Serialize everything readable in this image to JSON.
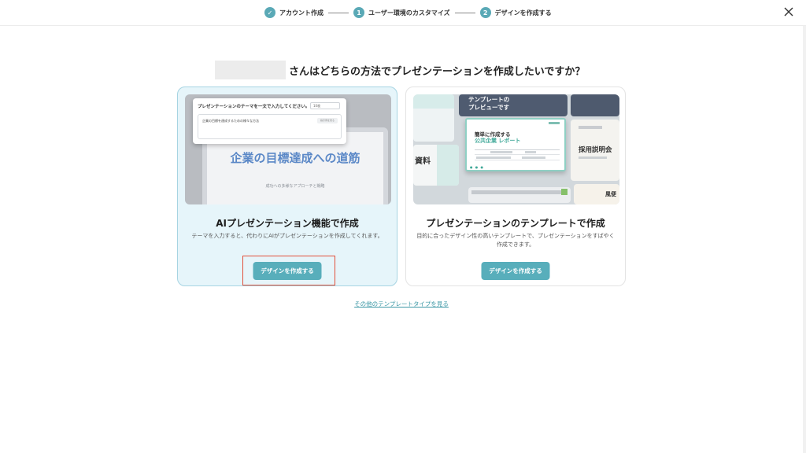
{
  "stepper": {
    "steps": [
      {
        "marker": "✓",
        "label": "アカウント作成"
      },
      {
        "marker": "1",
        "label": "ユーザー環境のカスタマイズ"
      },
      {
        "marker": "2",
        "label": "デザインを作成する"
      }
    ]
  },
  "heading": {
    "question": "さんはどちらの方法でプレゼンテーションを作成したいですか？"
  },
  "cards": [
    {
      "title": "AIプレゼンテーション機能で作成",
      "description": "テーマを入力すると、代わりにAIがプレゼンテーションを作成してくれます。",
      "button_label": "デザインを作成する",
      "preview": {
        "prompt_label": "プレゼンテーションのテーマを一文で入力してください。",
        "select_value": "10枚",
        "input_text": "企業の目標を達成するための様々な方法",
        "chip_label": "指示例を見る",
        "slide_title": "企業の目標達成への道筋",
        "slide_subtitle": "成功への多様なアプローチと戦略"
      }
    },
    {
      "title": "プレゼンテーションのテンプレートで作成",
      "description": "目的に合ったデザイン性の高いテンプレートで、プレゼンテーションをすばやく作成できます。",
      "button_label": "デザインを作成する",
      "preview": {
        "banner_text": "テンプレートの\nプレビューです",
        "main_line1": "簡単に作成する",
        "main_line2": "公共企業 レポート",
        "left_tile_text": "資料",
        "right_tile_text": "採用説明会",
        "bottom_tile_text": "風便"
      }
    }
  ],
  "footer": {
    "more_link": "その他のテンプレートタイプを見る"
  },
  "colors": {
    "accent": "#58aebb",
    "selected_card_bg": "#e6f5fa",
    "highlight_frame": "#e2503a"
  },
  "icons": {
    "close": "close-icon",
    "check": "check-icon"
  }
}
